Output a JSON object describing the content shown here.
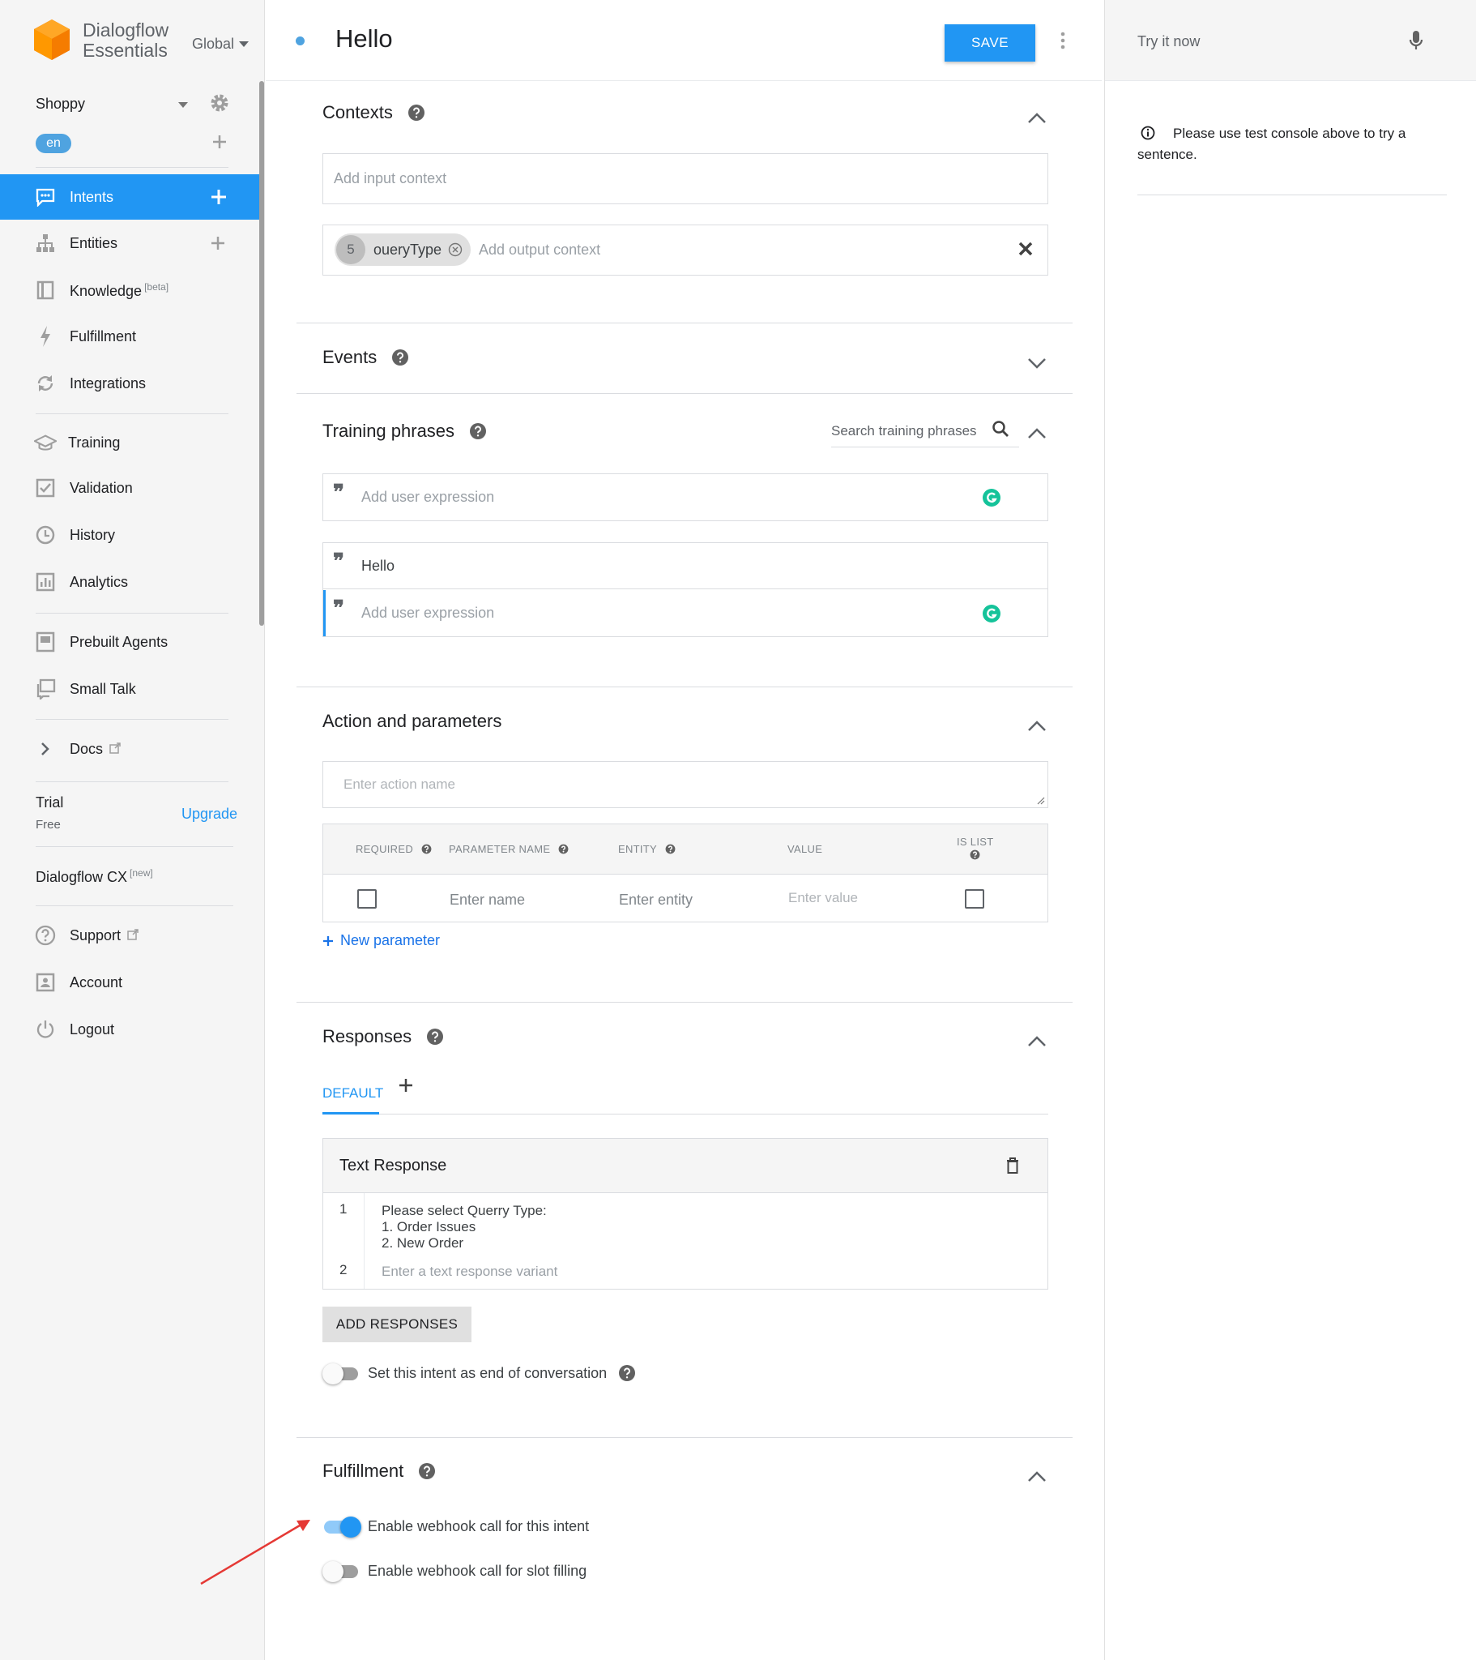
{
  "app": {
    "brand_line1": "Dialogflow",
    "brand_line2": "Essentials",
    "region": "Global"
  },
  "agent": {
    "name": "Shoppy",
    "language": "en"
  },
  "sidebar": {
    "items": [
      {
        "label": "Intents",
        "icon": "chat-bubble-icon",
        "has_add": true,
        "active": true
      },
      {
        "label": "Entities",
        "icon": "hierarchy-icon",
        "has_add": true
      },
      {
        "label": "Knowledge",
        "icon": "book-icon",
        "badge": "[beta]"
      },
      {
        "label": "Fulfillment",
        "icon": "lightning-icon"
      },
      {
        "label": "Integrations",
        "icon": "sync-icon"
      },
      {
        "label": "Training",
        "icon": "graduation-cap-icon"
      },
      {
        "label": "Validation",
        "icon": "check-box-icon"
      },
      {
        "label": "History",
        "icon": "clock-icon"
      },
      {
        "label": "Analytics",
        "icon": "bar-chart-icon"
      },
      {
        "label": "Prebuilt Agents",
        "icon": "agent-book-icon"
      },
      {
        "label": "Small Talk",
        "icon": "small-talk-icon"
      },
      {
        "label": "Docs",
        "icon": "chevron-right-icon"
      }
    ],
    "trial": {
      "label": "Trial",
      "plan": "Free",
      "upgrade": "Upgrade"
    },
    "cx": {
      "label": "Dialogflow CX",
      "badge": "[new]"
    },
    "bottom": [
      {
        "label": "Support",
        "icon": "help-circle-icon"
      },
      {
        "label": "Account",
        "icon": "account-box-icon"
      },
      {
        "label": "Logout",
        "icon": "power-icon"
      }
    ]
  },
  "header": {
    "intent_name": "Hello",
    "save_label": "SAVE"
  },
  "contexts": {
    "title": "Contexts",
    "input_placeholder": "Add input context",
    "output_chip": {
      "lifespan": "5",
      "name": "oueryType"
    },
    "output_placeholder": "Add output context"
  },
  "events": {
    "title": "Events"
  },
  "training": {
    "title": "Training phrases",
    "search_placeholder": "Search training phrases",
    "add_placeholder": "Add user expression",
    "phrases": [
      "Hello"
    ]
  },
  "action": {
    "title": "Action and parameters",
    "action_placeholder": "Enter action name",
    "columns": [
      "REQUIRED",
      "PARAMETER NAME",
      "ENTITY",
      "VALUE",
      "IS LIST"
    ],
    "row_placeholders": {
      "name": "Enter name",
      "entity": "Enter entity",
      "value": "Enter value"
    },
    "new_parameter": "New parameter"
  },
  "responses": {
    "title": "Responses",
    "tab_default": "DEFAULT",
    "card_title": "Text Response",
    "rows": [
      {
        "n": "1",
        "lines": [
          "Please select Querry Type:",
          "1. Order Issues",
          "2. New Order"
        ]
      },
      {
        "n": "2",
        "placeholder": "Enter a text response variant"
      }
    ],
    "add_button": "ADD RESPONSES",
    "end_conversation": "Set this intent as end of conversation",
    "end_conversation_on": false
  },
  "fulfillment": {
    "title": "Fulfillment",
    "webhook_label": "Enable webhook call for this intent",
    "webhook_on": true,
    "slot_label": "Enable webhook call for slot filling",
    "slot_on": false
  },
  "test_console": {
    "placeholder": "Try it now",
    "hint": "Please use test console above to try a sentence."
  },
  "colors": {
    "accent": "#2196f3",
    "grammarly": "#15c39a",
    "annotation_arrow": "#e53935"
  }
}
